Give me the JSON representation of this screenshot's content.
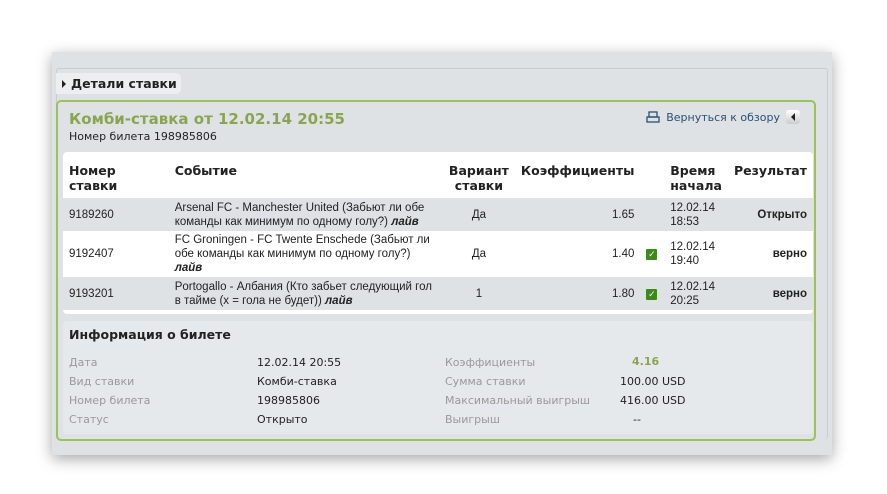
{
  "tab": {
    "label": "Детали ставки"
  },
  "header": {
    "title": "Комби-ставка от 12.02.14 20:55",
    "ticket": "Номер билета 198985806",
    "back_label": "Вернуться к обзору"
  },
  "table": {
    "headers": [
      "Номер ставки",
      "Событие",
      "Вариант ставки",
      "Коэффициенты",
      "",
      "Время начала",
      "Результат"
    ],
    "rows": [
      {
        "id": "9189260",
        "event": "Arsenal FC - Manchester United (Забьют ли обе команды как минимум по одному голу?)",
        "live": "лайв",
        "variant": "Да",
        "odds": "1.65",
        "check": false,
        "date": "12.02.14",
        "time": "18:53",
        "result": "Открыто"
      },
      {
        "id": "9192407",
        "event": "FC Groningen - FC Twente Enschede (Забьют ли обе команды как минимум по одному голу?)",
        "live": "лайв",
        "variant": "Да",
        "odds": "1.40",
        "check": true,
        "date": "12.02.14",
        "time": "19:40",
        "result": "верно"
      },
      {
        "id": "9193201",
        "event": "Portogallo - Албания (Кто забьет следующий гол в тайме (x = гола не будет))",
        "live": "лайв",
        "variant": "1",
        "odds": "1.80",
        "check": true,
        "date": "12.02.14",
        "time": "20:25",
        "result": "верно"
      }
    ]
  },
  "info": {
    "title": "Информация о билете",
    "left": [
      {
        "label": "Дата",
        "value": "12.02.14 20:55"
      },
      {
        "label": "Вид ставки",
        "value": "Комби-ставка"
      },
      {
        "label": "Номер билета",
        "value": "198985806"
      },
      {
        "label": "Статус",
        "value": "Открыто"
      }
    ],
    "right": [
      {
        "label": "Коэффициенты",
        "value": "4.16"
      },
      {
        "label": "Сумма ставки",
        "value": "100.00 USD"
      },
      {
        "label": "Максимальный выигрыш",
        "value": "416.00 USD"
      },
      {
        "label": "Выигрыш",
        "value": "--"
      }
    ]
  },
  "colors": {
    "accent": "#8aa550",
    "check": "#3d8a1a"
  }
}
